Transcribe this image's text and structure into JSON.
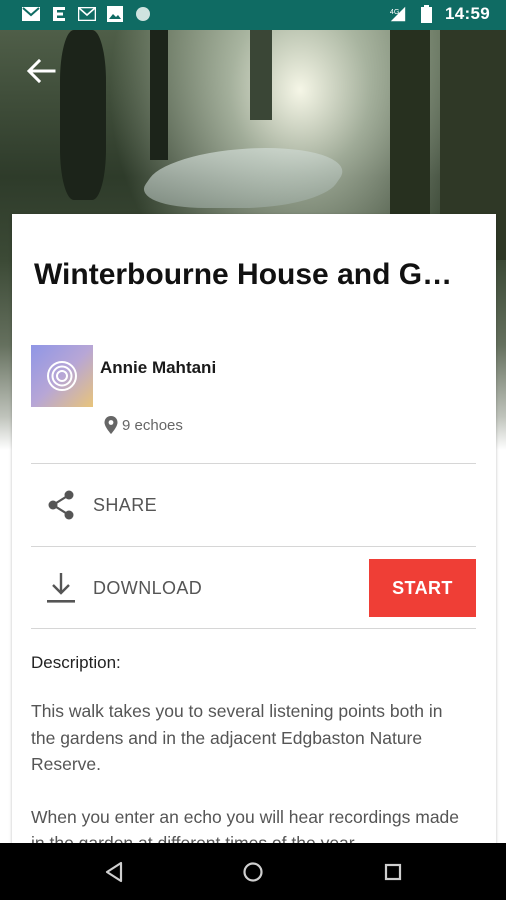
{
  "status_bar": {
    "time": "14:59",
    "network": "4G",
    "left_icons": [
      "gmail-icon",
      "e-app-icon",
      "mail-icon",
      "image-icon",
      "circle-app-icon"
    ]
  },
  "walk": {
    "title": "Winterbourne House and G…",
    "author": "Annie Mahtani",
    "echoes": "9 echoes"
  },
  "actions": {
    "share_label": "SHARE",
    "download_label": "DOWNLOAD",
    "start_label": "START"
  },
  "description": {
    "heading": "Description:",
    "paragraphs": [
      "This walk takes you to several listening points both in the gardens and in the adjacent Edgbaston Nature Reserve.",
      "When you enter an echo you will hear recordings made in the garden at different times of the year."
    ]
  },
  "colors": {
    "status_bar": "#0f6b63",
    "start_button": "#ef3e36",
    "nav_bar": "#000000"
  }
}
